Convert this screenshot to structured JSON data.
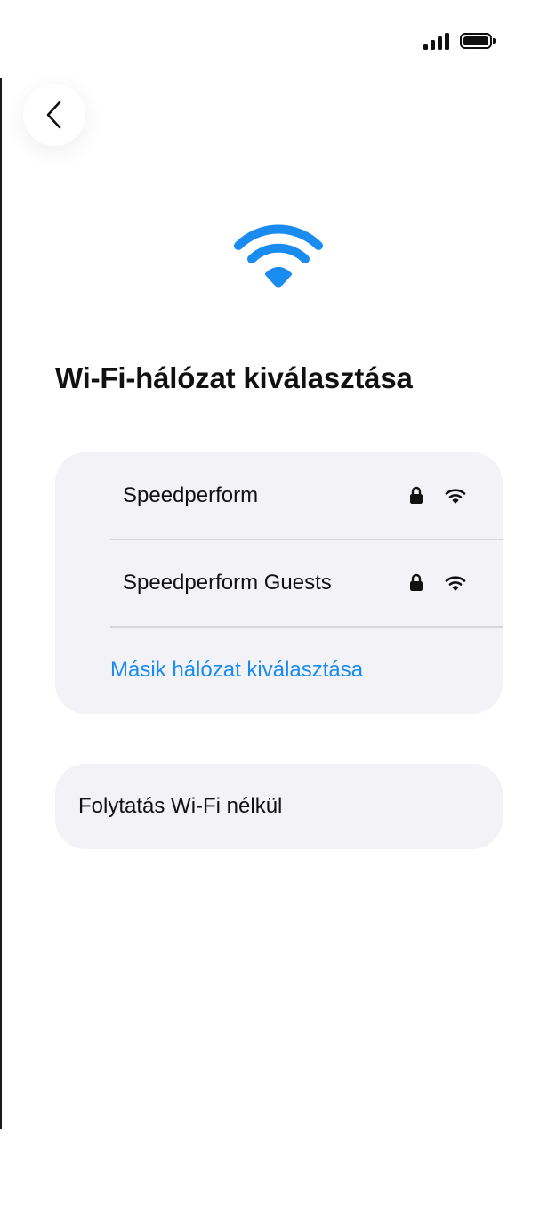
{
  "status_bar": {
    "signal_icon": "cellular-signal-icon",
    "battery_icon": "battery-icon"
  },
  "header": {
    "back_icon": "chevron-left-icon"
  },
  "hero": {
    "icon": "wifi-icon",
    "icon_color": "#1a8cf0"
  },
  "page": {
    "title": "Wi-Fi-hálózat kiválasztása"
  },
  "networks": [
    {
      "name": "Speedperform",
      "secured": true,
      "icons": [
        "lock-icon",
        "wifi-signal-icon"
      ]
    },
    {
      "name": "Speedperform Guests",
      "secured": true,
      "icons": [
        "lock-icon",
        "wifi-signal-icon"
      ]
    }
  ],
  "other_network": {
    "label": "Másik hálózat kiválasztása",
    "color": "#1a8cf0"
  },
  "continue_without_wifi": {
    "label": "Folytatás Wi-Fi nélkül"
  },
  "colors": {
    "card_background": "#f2f2f7",
    "accent": "#1a8cf0",
    "text": "#111111"
  }
}
